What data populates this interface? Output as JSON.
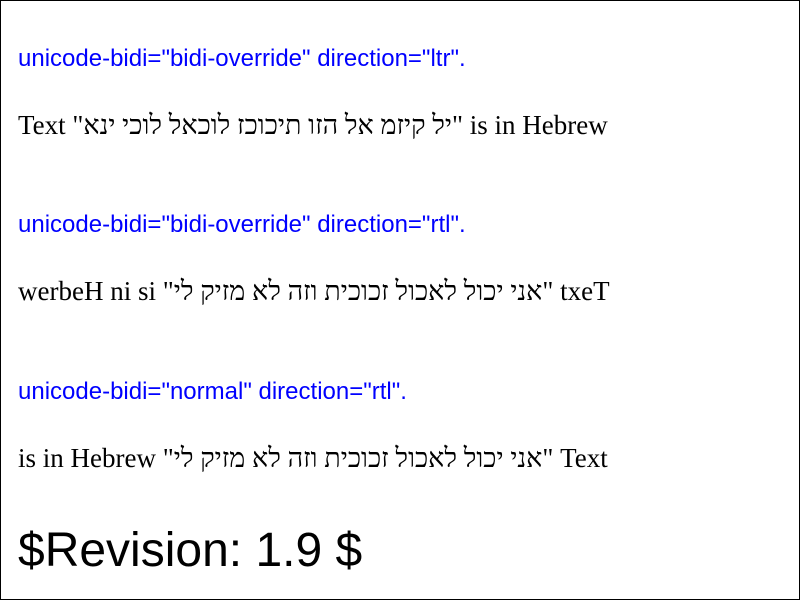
{
  "colors": {
    "caption": "#0000ff",
    "text": "#000000",
    "border": "#000000",
    "background": "#ffffff"
  },
  "tests": [
    {
      "caption": "unicode-bidi=\"bidi-override\" direction=\"ltr\".",
      "sample": "Text \"אני יכול לאכול זכוכית וזה לא מזיק לי\" is in Hebrew"
    },
    {
      "caption": "unicode-bidi=\"bidi-override\" direction=\"rtl\".",
      "sample": "Text \"אני יכול לאכול זכוכית וזה לא מזיק לי\" is in Hebrew"
    },
    {
      "caption": "unicode-bidi=\"normal\" direction=\"rtl\".",
      "sample": "Text \"אני יכול לאכול זכוכית וזה לא מזיק לי\" is in Hebrew"
    }
  ],
  "revision": "$Revision: 1.9 $"
}
